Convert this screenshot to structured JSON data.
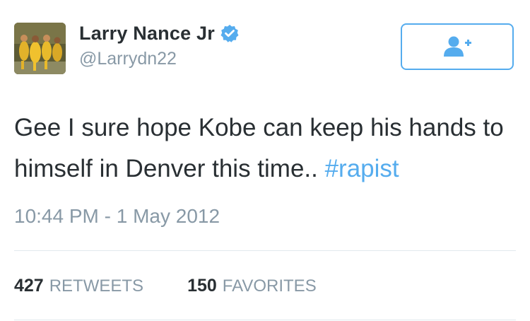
{
  "user": {
    "display_name": "Larry Nance Jr",
    "handle": "@Larrydn22",
    "verified": true
  },
  "follow_button": {
    "icon": "add-user-icon"
  },
  "tweet": {
    "text": "Gee I sure hope Kobe can keep his hands to himself in Denver this time.. ",
    "hashtag": "#rapist",
    "timestamp": "10:44 PM - 1 May 2012"
  },
  "stats": {
    "retweets_count": "427",
    "retweets_label": "RETWEETS",
    "favorites_count": "150",
    "favorites_label": "FAVORITES"
  },
  "colors": {
    "accent": "#55acee",
    "text": "#292f33",
    "muted": "#8899a6",
    "divider": "#e1e8ed"
  }
}
